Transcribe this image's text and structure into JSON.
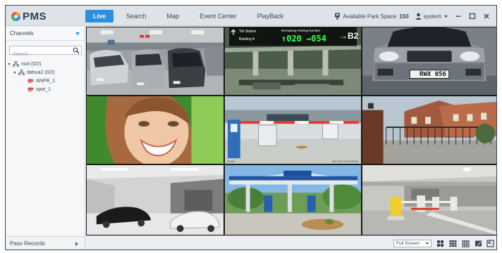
{
  "app": {
    "logo_text": "PMS"
  },
  "nav": {
    "tabs": [
      {
        "label": "Live",
        "active": true
      },
      {
        "label": "Search",
        "active": false
      },
      {
        "label": "Map",
        "active": false
      },
      {
        "label": "Event Center",
        "active": false
      },
      {
        "label": "PlayBack",
        "active": false
      }
    ]
  },
  "status": {
    "park_space_label": "Available Park Space",
    "park_space_count": "150",
    "user": "system"
  },
  "sidebar": {
    "title": "Channels",
    "search_placeholder": "Search...",
    "tree": [
      {
        "label": "root (0/2)",
        "icon": "network-icon"
      },
      {
        "label": "dahua2 (0/2)",
        "icon": "network-icon"
      },
      {
        "label": "ANPR_1",
        "icon": "camera-icon"
      },
      {
        "label": "spot_1",
        "icon": "camera-icon"
      }
    ],
    "footer": "Pass Records"
  },
  "grid": {
    "tiles": [
      {
        "name": "garage-cars-view"
      },
      {
        "name": "parking-sign-view",
        "sign_top_left": "Toll Station",
        "sign_bottom_left": "Building A",
        "sign_header": "Remaining Parking Number",
        "sign_value_1": "020",
        "sign_value_2": "054",
        "sign_dest": "B2"
      },
      {
        "name": "license-plate-view",
        "plate": "RWX 056"
      },
      {
        "name": "smiling-woman-view"
      },
      {
        "name": "toll-barrier-view",
        "stamp_left": "0/3/09",
        "stamp_right": "2017-09-21 00:00:00"
      },
      {
        "name": "gated-house-view"
      },
      {
        "name": "showroom-view"
      },
      {
        "name": "gas-station-view"
      },
      {
        "name": "parking-gate-view"
      }
    ]
  },
  "bottom": {
    "screen_mode": "Full Screen",
    "layout_icons": [
      "grid-4-icon",
      "grid-9-icon",
      "grid-16-icon",
      "pencil-icon",
      "expand-icon"
    ]
  },
  "colors": {
    "accent": "#2b8fe3",
    "frame": "#3a4654",
    "video_bg": "#202020"
  }
}
